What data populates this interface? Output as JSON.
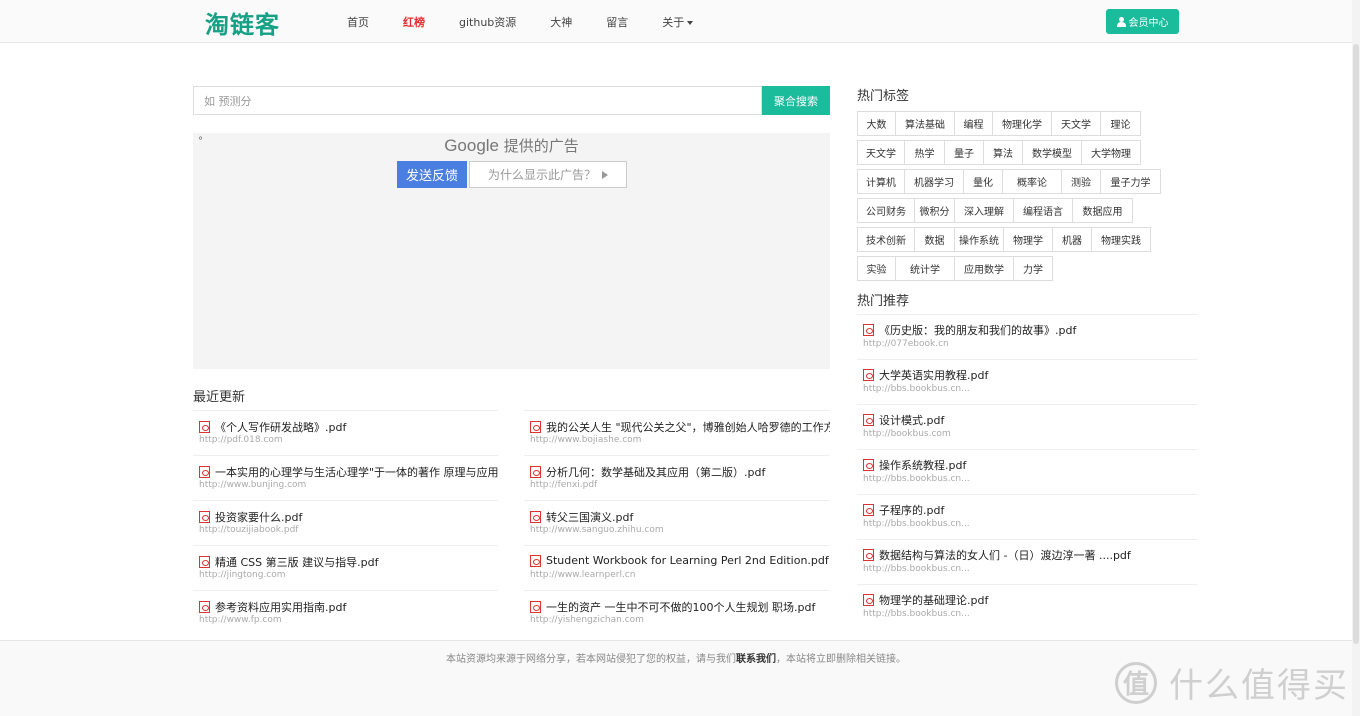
{
  "logo": "淘链客",
  "nav": {
    "items": [
      {
        "label": "首页",
        "hot": false
      },
      {
        "label": "红榜",
        "hot": true
      },
      {
        "label": "github资源",
        "hot": false
      },
      {
        "label": "大神",
        "hot": false
      },
      {
        "label": "留言",
        "hot": false
      },
      {
        "label": "关于",
        "hot": false
      }
    ],
    "member": "会员中心"
  },
  "search": {
    "placeholder": "如 预测分",
    "button": "聚合搜索"
  },
  "ad": {
    "dot": "°",
    "brand": "Google",
    "provided": "提供的广告",
    "feedback": "发送反馈",
    "why": "为什么显示此广告？"
  },
  "recent": {
    "title": "最近更新",
    "items": [
      {
        "title": "《个人写作研发战略》.pdf",
        "url": "http://pdf.018.com"
      },
      {
        "title": "我的公关人生 \"现代公关之父\"，博雅创始人哈罗德的工作方法",
        "url": "http://www.bojiashe.com"
      },
      {
        "title": "一本实用的心理学与生活心理学\"于一体的著作 原理与应用",
        "url": "http://www.bunjing.com"
      },
      {
        "title": "分析几何：数学基础及其应用（第二版）.pdf",
        "url": "http://fenxi.pdf"
      },
      {
        "title": "投资家要什么.pdf",
        "url": "http://touzijiabook.pdf"
      },
      {
        "title": "转父三国演义.pdf",
        "url": "http://www.sanguo.zhihu.com"
      },
      {
        "title": "精通 CSS 第三版 建议与指导.pdf",
        "url": "http://jingtong.com"
      },
      {
        "title": "Student Workbook for Learning Perl 2nd Edition.pdf",
        "url": "http://www.learnperl.cn"
      },
      {
        "title": "参考资料应用实用指南.pdf",
        "url": "http://www.fp.com"
      },
      {
        "title": "一生的资产 一生中不可不做的100个人生规划 职场.pdf",
        "url": "http://yishengzichan.com"
      }
    ]
  },
  "tags": {
    "title": "热门标签",
    "rows": [
      [
        "大数",
        "算法基础",
        "编程",
        "物理化学",
        "天文学",
        "理论"
      ],
      [
        "天文学",
        "热学",
        "量子",
        "算法",
        "数学模型",
        "大学物理"
      ],
      [
        "计算机",
        "机器学习",
        "量化",
        "概率论",
        "测验",
        "量子力学"
      ],
      [
        "公司财务",
        "微积分",
        "深入理解",
        "编程语言",
        "数据应用"
      ],
      [
        "技术创新",
        "数据",
        "操作系统",
        "物理学",
        "机器",
        "物理实践"
      ],
      [
        "实验",
        "统计学",
        "应用数学",
        "力学"
      ]
    ]
  },
  "rec": {
    "title": "热门推荐",
    "items": [
      {
        "title": "《历史版：我的朋友和我们的故事》.pdf",
        "url": "http://077ebook.cn"
      },
      {
        "title": "大学英语实用教程.pdf",
        "url": "http://bbs.bookbus.cn..."
      },
      {
        "title": "设计模式.pdf",
        "url": "http://bookbus.com"
      },
      {
        "title": "操作系统教程.pdf",
        "url": "http://bbs.bookbus.cn..."
      },
      {
        "title": "子程序的.pdf",
        "url": "http://bbs.bookbus.cn..."
      },
      {
        "title": "数据结构与算法的女人们 -（日）渡边淳一著 ....pdf",
        "url": "http://bbs.bookbus.cn..."
      },
      {
        "title": "物理学的基础理论.pdf",
        "url": "http://bbs.bookbus.cn..."
      }
    ]
  },
  "footer": {
    "text_before": "本站资源均来源于网络分享，若本网站侵犯了您的权益，请与我们",
    "contact": "联系我们",
    "text_after": "，本站将立即删除相关链接。"
  },
  "watermark": {
    "circle": "值",
    "text": "什么值得买"
  }
}
